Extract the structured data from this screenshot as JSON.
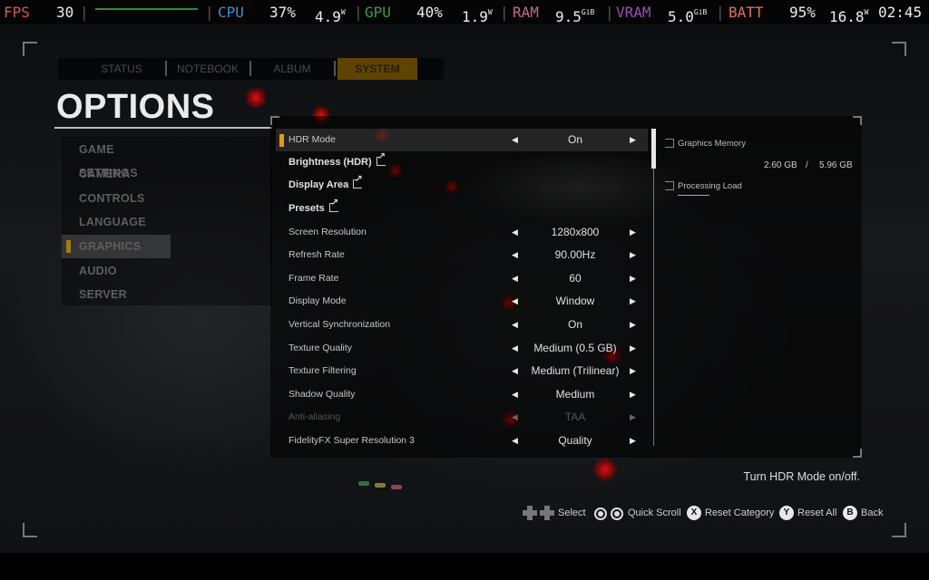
{
  "hud": {
    "fps_label": "FPS",
    "fps_value": "30",
    "cpu_label": "CPU",
    "cpu_value": "37%",
    "cpu_power": "4.9",
    "cpu_power_unit": "W",
    "gpu_label": "GPU",
    "gpu_value": "40%",
    "gpu_power": "1.9",
    "gpu_power_unit": "W",
    "ram_label": "RAM",
    "ram_value": "9.5",
    "ram_unit": "GiB",
    "vram_label": "VRAM",
    "vram_value": "5.0",
    "vram_unit": "GiB",
    "batt_label": "BATT",
    "batt_value": "95%",
    "batt_power": "16.8",
    "batt_power_unit": "W",
    "clock": "02:45",
    "colors": {
      "fps": "#d9534f",
      "cpu": "#3f8fcf",
      "gpu": "#3c9a4a",
      "ram": "#c06a8a",
      "vram": "#9a4fb0",
      "batt": "#e0705a"
    }
  },
  "tabs": [
    {
      "label": "STATUS",
      "active": false
    },
    {
      "label": "NOTEBOOK",
      "active": false
    },
    {
      "label": "ALBUM",
      "active": false
    },
    {
      "label": "SYSTEM",
      "active": true
    }
  ],
  "page_title": "OPTIONS",
  "sidebar": {
    "items": [
      {
        "label": "GAME SETTINGS"
      },
      {
        "label": "CAMERA"
      },
      {
        "label": "CONTROLS"
      },
      {
        "label": "LANGUAGE"
      },
      {
        "label": "GRAPHICS",
        "active": true
      },
      {
        "label": "AUDIO"
      },
      {
        "label": "SERVER"
      }
    ]
  },
  "options": [
    {
      "label": "HDR Mode",
      "value": "On",
      "active": true
    },
    {
      "label": "Brightness (HDR)",
      "external": true
    },
    {
      "label": "Display Area",
      "external": true
    },
    {
      "label": "Presets",
      "external": true
    },
    {
      "label": "Screen Resolution",
      "value": "1280x800"
    },
    {
      "label": "Refresh Rate",
      "value": "90.00Hz"
    },
    {
      "label": "Frame Rate",
      "value": "60"
    },
    {
      "label": "Display Mode",
      "value": "Window"
    },
    {
      "label": "Vertical Synchronization",
      "value": "On"
    },
    {
      "label": "Texture Quality",
      "value": "Medium (0.5 GB)"
    },
    {
      "label": "Texture Filtering",
      "value": "Medium (Trilinear)"
    },
    {
      "label": "Shadow Quality",
      "value": "Medium"
    },
    {
      "label": "Anti-aliasing",
      "value": "TAA",
      "disabled": true
    },
    {
      "label": "FidelityFX Super Resolution 3",
      "value": "Quality"
    }
  ],
  "arrows": {
    "left": "◀",
    "right": "▶"
  },
  "info": {
    "graphics_memory_label": "Graphics Memory",
    "graphics_memory_used": "2.60 GB",
    "graphics_memory_sep": "/",
    "graphics_memory_total": "5.96 GB",
    "processing_load_label": "Processing Load"
  },
  "help_text": "Turn HDR Mode on/off.",
  "footer": {
    "select_label": "Select",
    "quick_scroll_label": "Quick Scroll",
    "reset_category_key": "X",
    "reset_category_label": "Reset Category",
    "reset_all_key": "Y",
    "reset_all_label": "Reset All",
    "back_key": "B",
    "back_label": "Back"
  },
  "accent_color": "#e09a1a"
}
